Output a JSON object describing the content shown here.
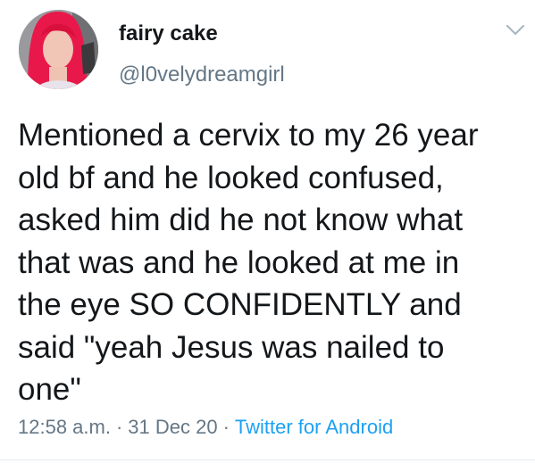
{
  "tweet": {
    "display_name": "fairy cake",
    "handle": "@l0velydreamgirl",
    "text_lines": [
      "Mentioned a cervix to my 26 year",
      "old bf and he looked confused,",
      "asked him did he not know what",
      "that was and he looked at me in",
      "the eye SO CONFIDENTLY and",
      "said \"yeah Jesus was nailed to",
      "one\""
    ],
    "time": "12:58 a.m.",
    "date": "31 Dec 20",
    "separator": "·",
    "source": "Twitter for Android"
  },
  "icons": {
    "caret": "chevron-down-icon",
    "avatar": "avatar"
  },
  "colors": {
    "text": "#14171a",
    "secondary": "#657786",
    "link": "#1da1f2",
    "hair": "#e8194a"
  }
}
